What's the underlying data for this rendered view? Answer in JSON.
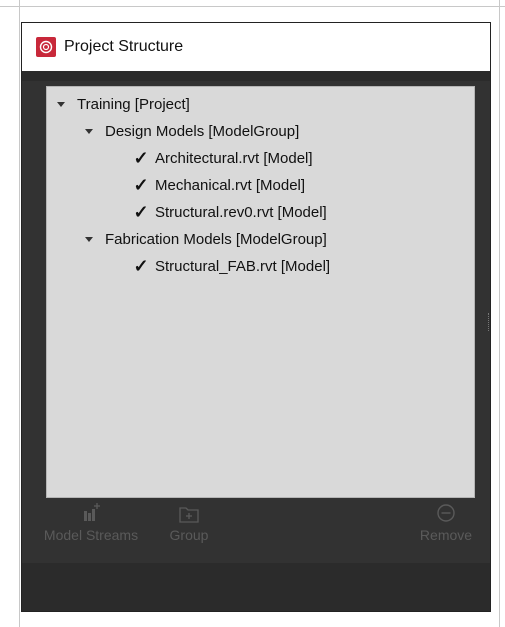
{
  "window": {
    "title": "Project Structure",
    "app_icon": "app-logo-icon",
    "accent": "#c8283a"
  },
  "tree": {
    "project": {
      "label": "Training [Project]",
      "expanded": true
    },
    "groups": [
      {
        "label": "Design Models [ModelGroup]",
        "expanded": true,
        "models": [
          {
            "label": "Architectural.rvt [Model]",
            "checked": true
          },
          {
            "label": "Mechanical.rvt [Model]",
            "checked": true
          },
          {
            "label": "Structural.rev0.rvt [Model]",
            "checked": true
          }
        ]
      },
      {
        "label": "Fabrication Models [ModelGroup]",
        "expanded": true,
        "models": [
          {
            "label": "Structural_FAB.rvt [Model]",
            "checked": true
          }
        ]
      }
    ]
  },
  "toolbar": {
    "model_streams_label": "Model Streams",
    "model_streams_icon": "model-streams-add-icon",
    "group_label": "Group",
    "group_icon": "add-group-icon",
    "remove_label": "Remove",
    "remove_icon": "remove-circle-icon"
  },
  "check_glyph": "✓"
}
